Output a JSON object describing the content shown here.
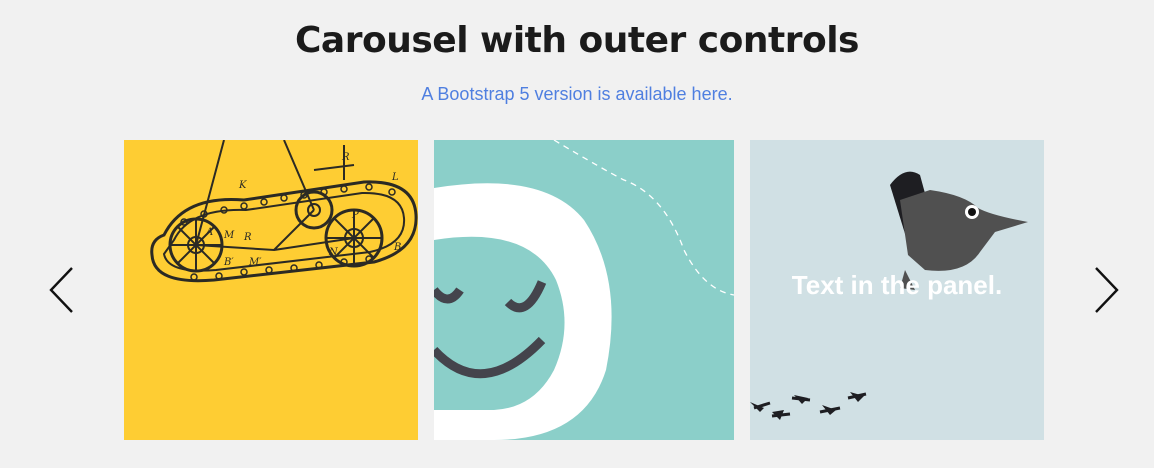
{
  "page": {
    "title": "Carousel with outer controls",
    "subtitle_link": "A Bootstrap 5 version is available here."
  },
  "carousel": {
    "panels": [
      {
        "image": "tracked-vehicle-patent-drawing",
        "background": "#fecd33"
      },
      {
        "image": "smiling-face-illustration",
        "background": "#8bcfc9"
      },
      {
        "image": "bird-head-with-footprints-illustration",
        "background": "#d0e0e4",
        "caption": "Text in the panel."
      }
    ],
    "controls": {
      "previous_icon": "chevron-left-icon",
      "next_icon": "chevron-right-icon"
    }
  },
  "colors": {
    "background": "#f1f1f1",
    "title": "#1b1b1b",
    "link": "#4f7fe0"
  }
}
